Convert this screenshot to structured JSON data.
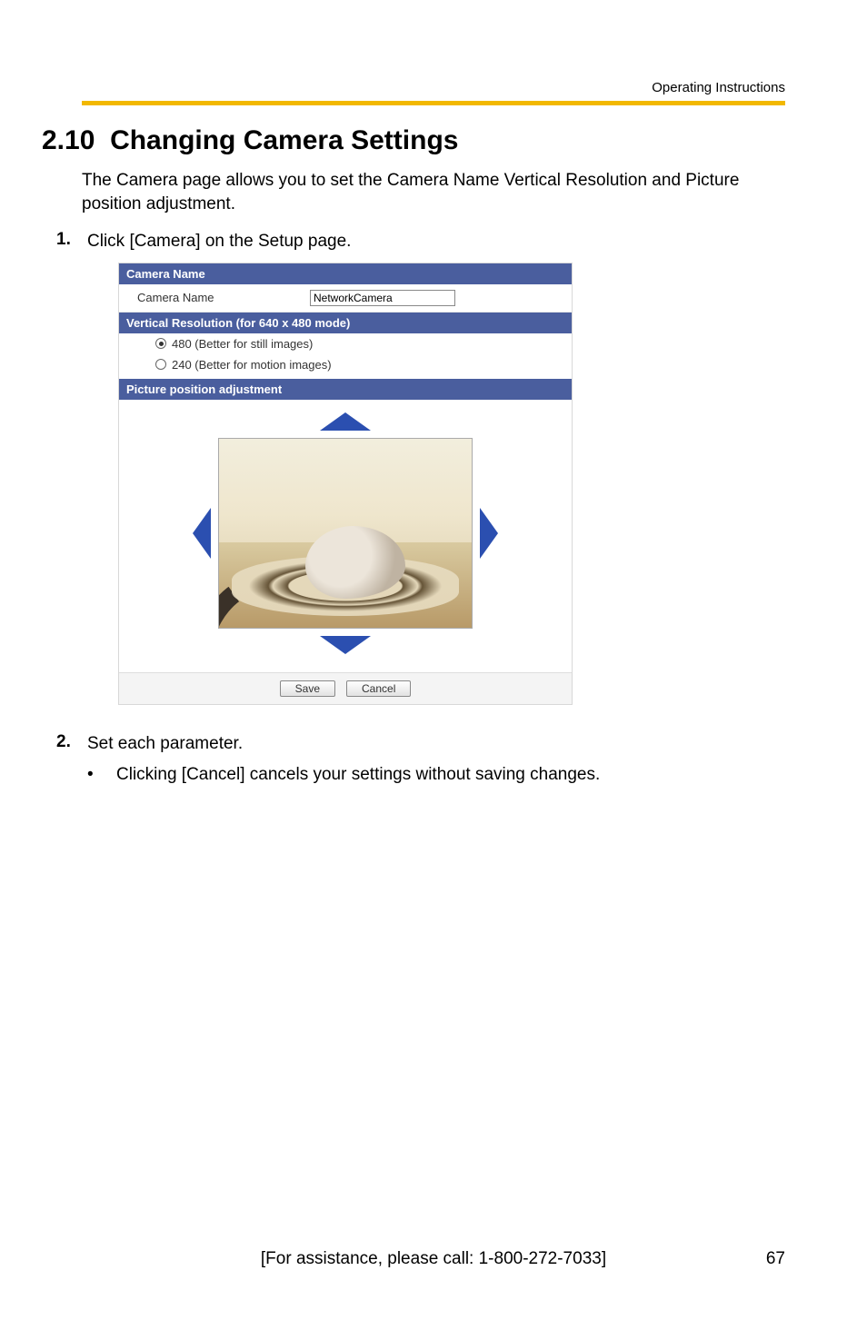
{
  "doc": {
    "header_label": "Operating Instructions",
    "section_number": "2.10",
    "section_title": "Changing Camera Settings",
    "intro": "The Camera page allows you to set the Camera Name Vertical Resolution and Picture position adjustment.",
    "step1_num": "1.",
    "step1_text": "Click [Camera] on the Setup page.",
    "step2_num": "2.",
    "step2_text": "Set each parameter.",
    "bullet_dot": "•",
    "bullet_text": "Clicking [Cancel] cancels your settings without saving changes.",
    "footer_center": "[For assistance, please call: 1-800-272-7033]",
    "page_number": "67"
  },
  "ui": {
    "camera_name_header": "Camera Name",
    "camera_name_label": "Camera Name",
    "camera_name_value": "NetworkCamera",
    "vres_header": "Vertical Resolution (for 640 x 480 mode)",
    "vres_opt1": "480 (Better for still images)",
    "vres_opt2": "240 (Better for motion images)",
    "picture_header": "Picture position adjustment",
    "save_label": "Save",
    "cancel_label": "Cancel"
  }
}
